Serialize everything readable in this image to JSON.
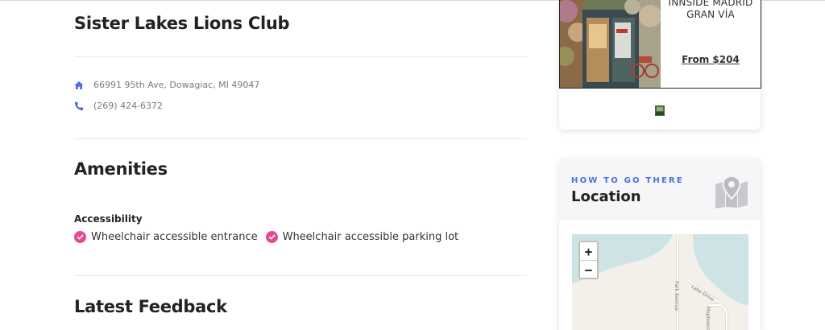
{
  "listing": {
    "title": "Sister Lakes Lions Club",
    "address": "66991 95th Ave, Dowagiac, MI 49047",
    "phone": "(269) 424-6372"
  },
  "amenities": {
    "heading": "Amenities",
    "category": "Accessibility",
    "items": [
      "Wheelchair accessible entrance",
      "Wheelchair accessible parking lot"
    ]
  },
  "feedback": {
    "heading": "Latest Feedback"
  },
  "ad": {
    "hotel_name_line1": "INNSIDE MADRID",
    "hotel_name_line2": "GRAN VÍA",
    "price": "From $204"
  },
  "location": {
    "eyebrow": "HOW TO GO THERE",
    "title": "Location",
    "zoom_in": "+",
    "zoom_out": "−",
    "road_labels": [
      "Park Avenue",
      "Lake Drive",
      "Maplewood"
    ]
  },
  "colors": {
    "accent_blue": "#4d6ae8",
    "check_pink": "#e8488f",
    "water": "#cde3e6"
  }
}
